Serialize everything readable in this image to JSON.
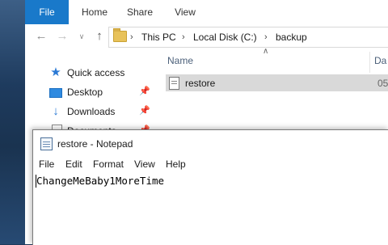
{
  "explorer": {
    "ribbon_tabs": [
      {
        "label": "File"
      },
      {
        "label": "Home"
      },
      {
        "label": "Share"
      },
      {
        "label": "View"
      }
    ],
    "breadcrumb": [
      "This PC",
      "Local Disk (C:)",
      "backup"
    ],
    "nav_items": [
      {
        "label": "Quick access",
        "icon": "star-icon",
        "pinned": false
      },
      {
        "label": "Desktop",
        "icon": "desktop-icon",
        "pinned": true
      },
      {
        "label": "Downloads",
        "icon": "download-icon",
        "pinned": true
      },
      {
        "label": "Documents",
        "icon": "documents-icon",
        "pinned": true
      }
    ],
    "columns": {
      "name": "Name",
      "date": "Da"
    },
    "files": [
      {
        "name": "restore",
        "date": "05"
      }
    ]
  },
  "notepad": {
    "title": "restore - Notepad",
    "menu": [
      "File",
      "Edit",
      "Format",
      "View",
      "Help"
    ],
    "content": "ChangeMeBaby1MoreTime"
  },
  "colors": {
    "file_tab_blue": "#1979ca",
    "selected_row": "#d9d9d9",
    "folder_yellow": "#e8c25a",
    "desktop_bg": "#1f3a5c"
  }
}
